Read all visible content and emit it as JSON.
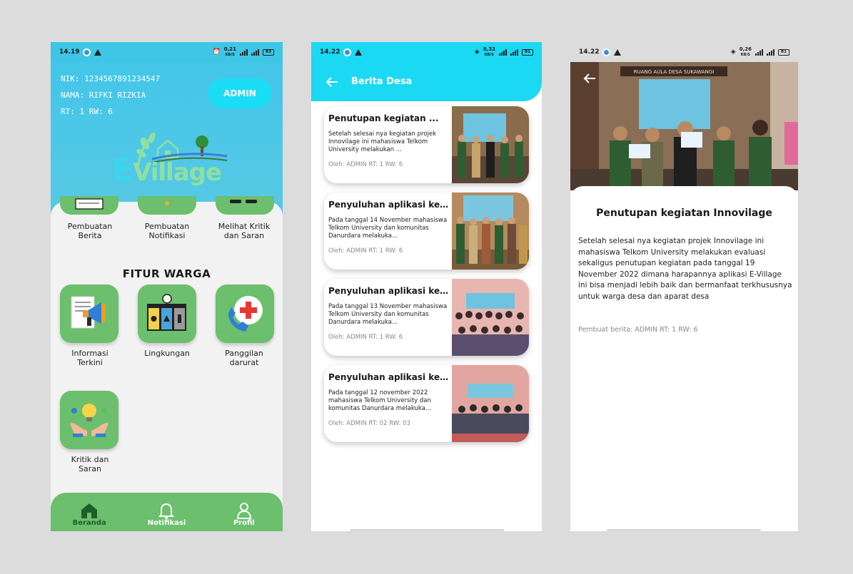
{
  "colors": {
    "cyan": "#43c6e9",
    "green_tile": "#6cbf6c",
    "header_cyan": "#1bd9f2"
  },
  "phone1": {
    "status": {
      "time": "14.19",
      "speed": "0,21",
      "speed_unit": "KB/S",
      "battery": "83"
    },
    "user": {
      "nik": "NIK: 1234567891234547",
      "nama": "NAMA: RIFKI RIZKIA",
      "rt": "RT: 1 RW: 6"
    },
    "admin_button": "ADMIN",
    "logo": {
      "first": "E",
      "rest": "Village"
    },
    "admin_features": [
      {
        "label": "Pembuatan\nBerita",
        "icon": "news-icon"
      },
      {
        "label": "Pembuatan\nNotifikasi",
        "icon": "notification-create-icon"
      },
      {
        "label": "Melihat Kritik\ndan Saran",
        "icon": "feedback-view-icon"
      }
    ],
    "section_title": "FITUR WARGA",
    "warga_features": [
      {
        "label": "Informasi\nTerkini",
        "icon": "megaphone-icon"
      },
      {
        "label": "Lingkungan",
        "icon": "trash-bins-icon"
      },
      {
        "label": "Panggilan\ndarurat",
        "icon": "emergency-call-icon"
      },
      {
        "label": "Kritik dan\nSaran",
        "icon": "lightbulb-hands-icon"
      }
    ],
    "nav": [
      {
        "label": "Beranda",
        "icon": "home-icon"
      },
      {
        "label": "Notifikasi",
        "icon": "bell-icon"
      },
      {
        "label": "Profil",
        "icon": "user-icon"
      }
    ]
  },
  "phone2": {
    "status": {
      "time": "14.22",
      "speed": "0,32",
      "speed_unit": "KB/S",
      "battery": "81"
    },
    "header_title": "Berita Desa",
    "cards": [
      {
        "title": "Penutupan kegiatan ...",
        "desc": "Setelah selesai nya kegiatan projek Innovilage ini mahasiswa Telkom University melakukan ...",
        "meta": "Oleh: ADMIN RT: 1 RW: 6"
      },
      {
        "title": "Penyuluhan aplikasi kepad...",
        "desc": "Pada tanggal 14 November mahasiswa Telkom University dan komunitas Danurdara melakuka...",
        "meta": "Oleh: ADMIN RT: 1 RW: 6"
      },
      {
        "title": "Penyuluhan aplikasi kepad...",
        "desc": "Pada tanggal 13 November mahasiswa Telkom University dan komunitas Danurdara melakuka...",
        "meta": "Oleh: ADMIN RT: 1 RW: 6"
      },
      {
        "title": "Penyuluhan aplikasi kepad...",
        "desc": "Pada tanggal 12 november 2022 mahasiswa Telkom University dan komunitas Danurdara melakuka...",
        "meta": "Oleh: ADMIN RT: 02 RW: 03"
      }
    ]
  },
  "phone3": {
    "status": {
      "time": "14.22",
      "speed": "0,26",
      "speed_unit": "KB/S",
      "battery": "81"
    },
    "photo_banner": "RUANG AULA DESA SUKAWANGI",
    "title": "Penutupan kegiatan Innovilage",
    "body": "Setelah selesai nya kegiatan projek Innovilage ini mahasiswa Telkom University melakukan evaluasi sekaligus penutupan kegiatan pada tanggal 19 November 2022 dimana harapannya aplikasi E-Village ini bisa menjadi lebih baik dan bermanfaat terkhususnya untuk warga desa dan aparat desa",
    "meta": "Pembuat berita: ADMIN RT: 1 RW: 6"
  }
}
